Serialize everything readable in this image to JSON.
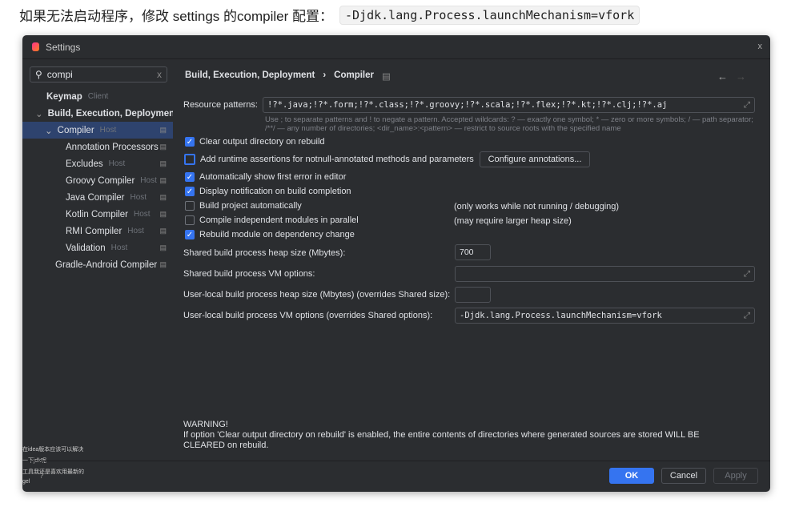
{
  "heading": {
    "text": "如果无法启动程序，修改 settings 的compiler 配置：",
    "code": "-Djdk.lang.Process.launchMechanism=vfork"
  },
  "dialog": {
    "title": "Settings",
    "close": "x"
  },
  "search": {
    "value": "compi",
    "clear": "x"
  },
  "sidebar": {
    "items": [
      {
        "label": "Keymap",
        "tag": "Client"
      },
      {
        "label": "Build, Execution, Deployment",
        "tag": ""
      },
      {
        "label": "Compiler",
        "tag": "Host"
      },
      {
        "label": "Annotation Processors",
        "tag": ""
      },
      {
        "label": "Excludes",
        "tag": "Host"
      },
      {
        "label": "Groovy Compiler",
        "tag": "Host"
      },
      {
        "label": "Java Compiler",
        "tag": "Host"
      },
      {
        "label": "Kotlin Compiler",
        "tag": "Host"
      },
      {
        "label": "RMI Compiler",
        "tag": "Host"
      },
      {
        "label": "Validation",
        "tag": "Host"
      },
      {
        "label": "Gradle-Android Compiler",
        "tag": ""
      }
    ]
  },
  "breadcrumb": {
    "parent": "Build, Execution, Deployment",
    "sep": "›",
    "current": "Compiler"
  },
  "main": {
    "resource_label": "Resource patterns:",
    "resource_value": "!?*.java;!?*.form;!?*.class;!?*.groovy;!?*.scala;!?*.flex;!?*.kt;!?*.clj;!?*.aj",
    "hint1": "Use ; to separate patterns and ! to negate a pattern. Accepted wildcards: ? — exactly one symbol; * — zero or more symbols; / — path separator;",
    "hint2": "/**/ — any number of directories; <dir_name>:<pattern> — restrict to source roots with the specified name",
    "checkboxes": [
      {
        "label": "Clear output directory on rebuild",
        "checked": true
      },
      {
        "label": "Add runtime assertions for notnull-annotated methods and parameters",
        "checked": false
      },
      {
        "label": "Automatically show first error in editor",
        "checked": true
      },
      {
        "label": "Display notification on build completion",
        "checked": true
      },
      {
        "label": "Build project automatically",
        "checked": false,
        "note": "(only works while not running / debugging)"
      },
      {
        "label": "Compile independent modules in parallel",
        "checked": false,
        "note": "(may require larger heap size)"
      },
      {
        "label": "Rebuild module on dependency change",
        "checked": true
      }
    ],
    "configure_button": "Configure annotations...",
    "heap_label": "Shared build process heap size (Mbytes):",
    "heap_value": "700",
    "vm_label": "Shared build process VM options:",
    "vm_value": "",
    "user_heap_label": "User-local build process heap size (Mbytes) (overrides Shared size):",
    "user_heap_value": "",
    "user_vm_label": "User-local build process VM options (overrides Shared options):",
    "user_vm_value": "-Djdk.lang.Process.launchMechanism=vfork",
    "warning_title": "WARNING!",
    "warning_text": "If option 'Clear output directory on rebuild' is enabled, the entire contents of directories where generated sources are stored WILL BE CLEARED on rebuild."
  },
  "footer": {
    "ok": "OK",
    "cancel": "Cancel",
    "apply": "Apply",
    "help": "?"
  },
  "background_fragments": [
    "在idea版本应该可以解决",
    "一下jdk呢",
    "工具我还是喜欢用最新的",
    "gel"
  ],
  "colors": {
    "accent": "#3574f0",
    "selection": "#2e436e",
    "dialog_bg": "#2b2d30"
  }
}
